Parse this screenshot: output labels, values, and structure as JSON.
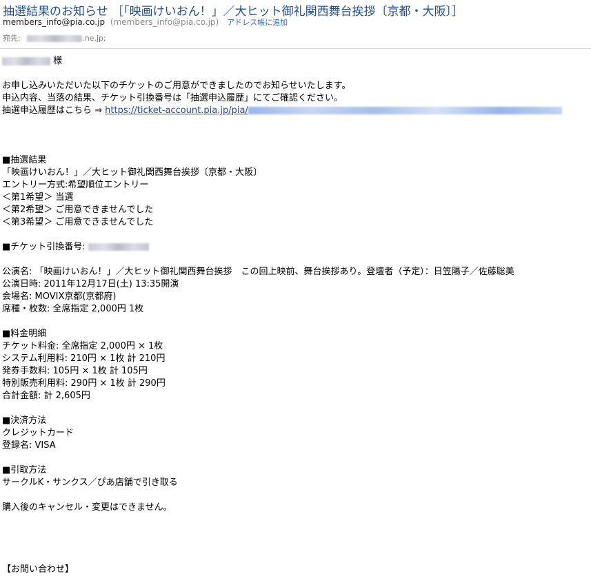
{
  "header": {
    "subject": "抽選結果のお知らせ ［「映画けいおん！」／大ヒット御礼関西舞台挨拶〔京都・大阪〕］",
    "from_email": "members_info@pia.co.jp",
    "from_email_paren": "(members_info@pia.co.jp)",
    "add_to_addressbook": "アドレス帳に追加",
    "to_label": "宛先:",
    "to_domain_suffix": ".ne.jp;"
  },
  "body": {
    "greeting_suffix": "様",
    "intro": [
      "お申し込みいただいた以下のチケットのご用意ができましたのでお知らせいたします。",
      "申込内容、当落の結果、チケット引換番号は「抽選申込履歴」にてご確認ください。"
    ],
    "history_prefix": "抽選申込履歴はこちら ⇒ ",
    "history_link": "https://ticket-account.pia.jp/pia/",
    "lottery": [
      "■抽選結果",
      "「映画けいおん！」／大ヒット御礼関西舞台挨拶〔京都・大阪〕",
      "エントリー方式:希望順位エントリー",
      "＜第1希望＞ 当選",
      "＜第2希望＞ ご用意できませんでした",
      "＜第3希望＞ ご用意できませんでした"
    ],
    "ticket_number_label": "■チケット引換番号:",
    "performance": [
      "公演名: 「映画けいおん！」／大ヒット御礼関西舞台挨拶　この回上映前、舞台挨拶あり。登壇者（予定）：日笠陽子／佐藤聡美",
      "公演日時:  2011年12月17日(土) 13:35開演",
      "会場名:  MOVIX京都(京都府)",
      "席種・枚数:  全席指定  2,000円  1枚"
    ],
    "fees": [
      "■料金明細",
      "チケット料金:  全席指定   2,000円  ×  1枚",
      "システム利用料:  210円  ×  1枚  計  210円",
      "発券手数料:  105円  ×  1枚  計  105円",
      "特別販売利用料:  290円  ×  1枚  計  290円",
      "合計金額:  計  2,605円"
    ],
    "payment": [
      "■決済方法",
      "クレジットカード",
      "登録名:  VISA"
    ],
    "pickup": [
      "■引取方法",
      "サークルK・サンクス／ぴあ店舗で引き取る"
    ],
    "cancel_note": "購入後のキャンセル・変更はできません。",
    "contact": "【お問い合わせ】"
  }
}
